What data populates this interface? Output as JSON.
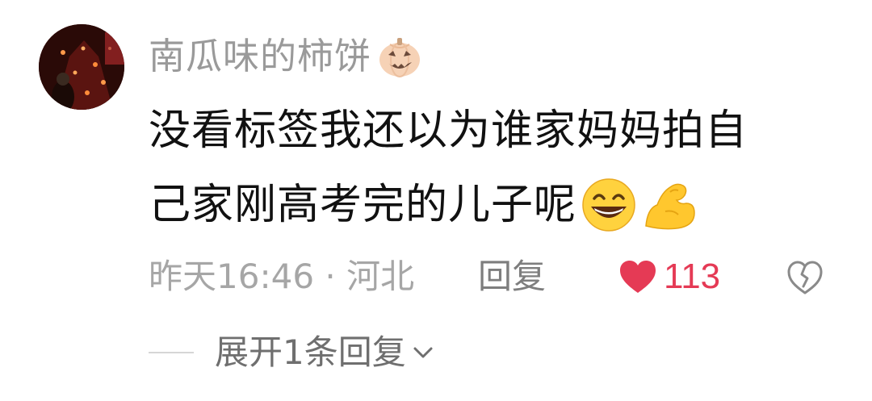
{
  "comment": {
    "username": "南瓜味的柿饼",
    "username_badge_icon": "pumpkin-icon",
    "body_lines": [
      "没看标签我还以为谁家妈妈拍自",
      "己家刚高考完的儿子呢"
    ],
    "body_emojis": [
      "grinning-face-icon",
      "flexed-biceps-icon"
    ],
    "meta": "昨天16:46 · 河北",
    "reply_label": "回复",
    "like_count": "113",
    "like_color": "#e53a55",
    "like_liked": true,
    "dislike_icon": "broken-heart-icon",
    "expand_replies_label": "展开1条回复"
  }
}
